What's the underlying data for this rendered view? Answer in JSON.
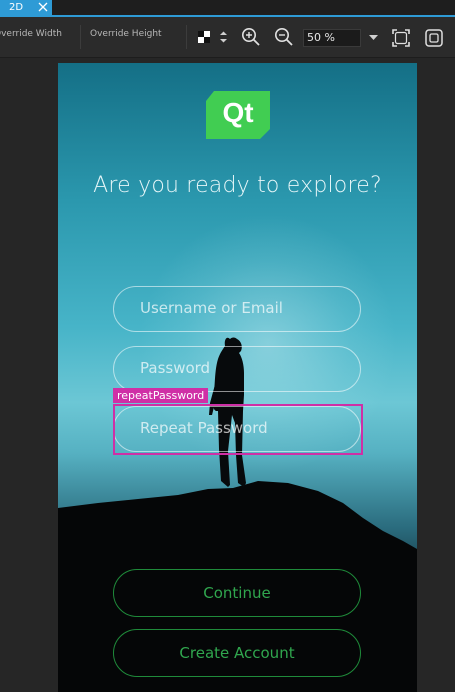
{
  "tab": {
    "label": "2D"
  },
  "toolbar": {
    "override_width": "Override Width",
    "override_height": "Override Height",
    "zoom_value": "50 %"
  },
  "app": {
    "logo_text": "Qt",
    "headline": "Are you ready to explore?",
    "username_placeholder": "Username or Email",
    "password_placeholder": "Password",
    "repeat_password_placeholder": "Repeat Password",
    "continue_label": "Continue",
    "create_account_label": "Create Account"
  },
  "selection": {
    "label": "repeatPassword"
  },
  "colors": {
    "accent_blue": "#2e9bd6",
    "selection_magenta": "#cf2fa6",
    "qt_green": "#41cd52",
    "button_green": "#30a64e"
  }
}
